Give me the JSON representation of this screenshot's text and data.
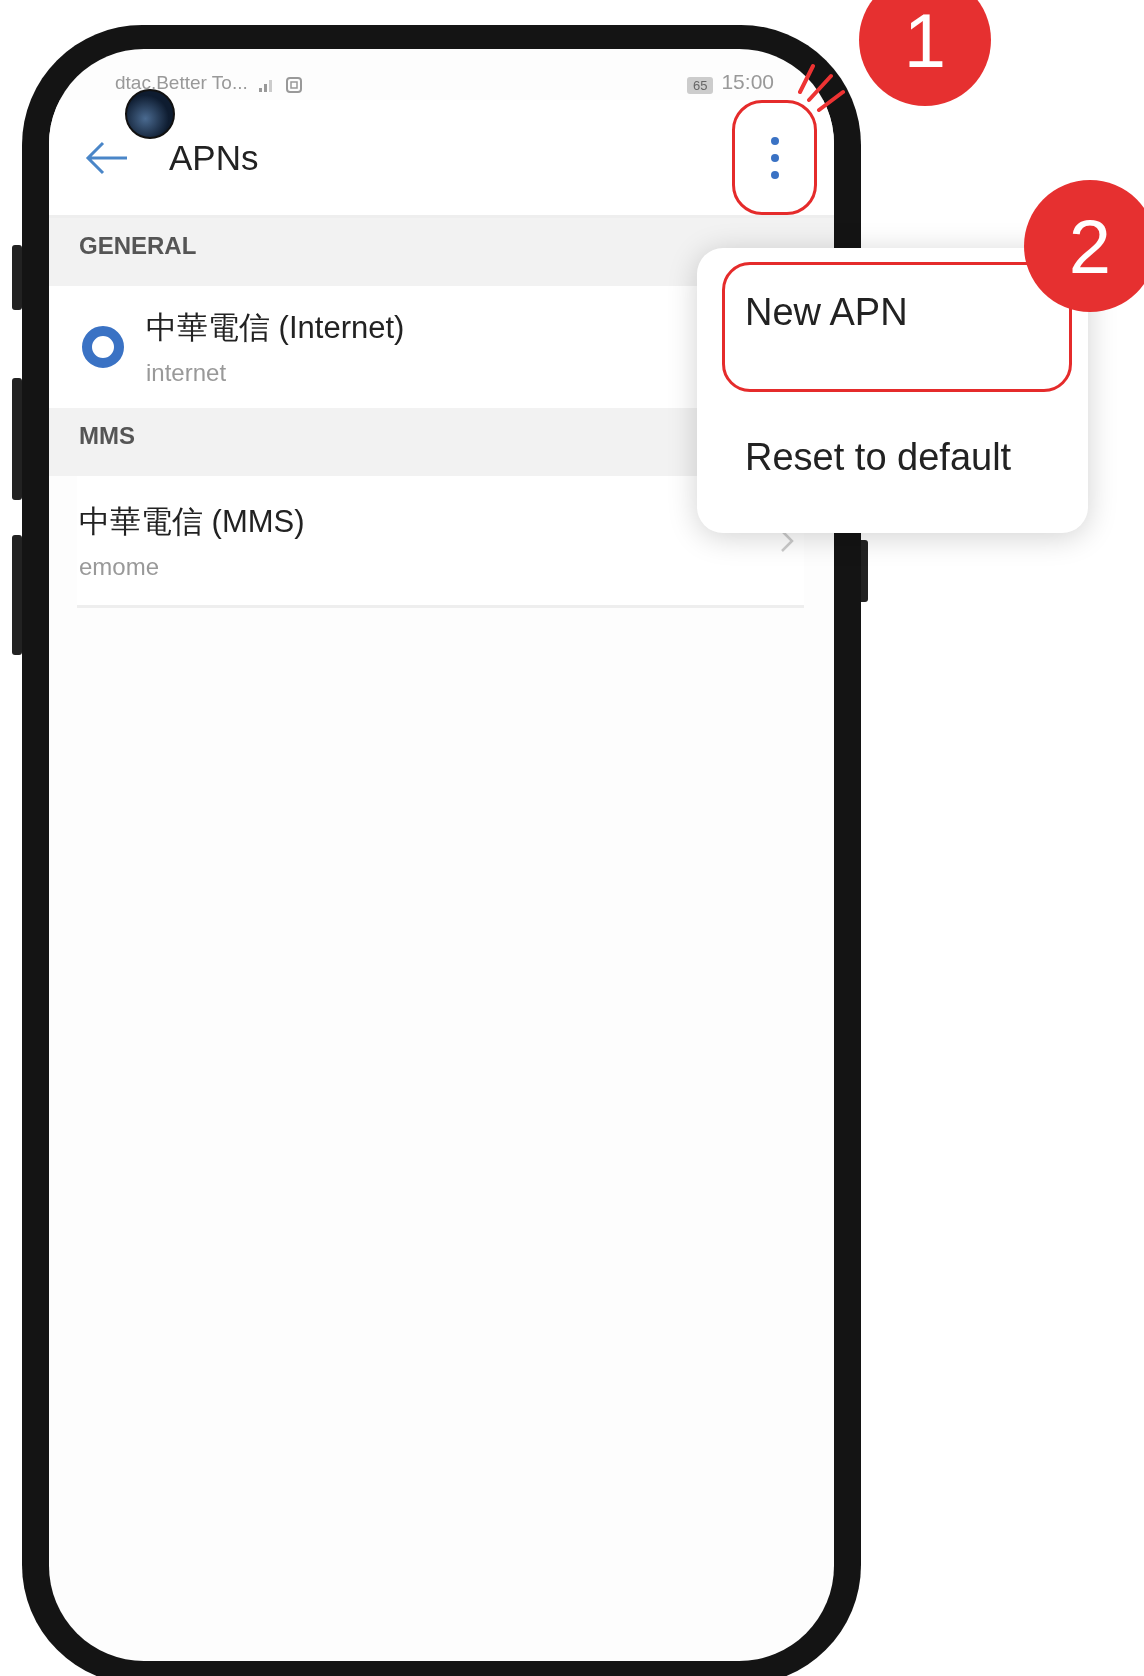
{
  "status_bar": {
    "carrier": "dtac.Better To...",
    "battery": "65",
    "time": "15:00"
  },
  "toolbar": {
    "title": "APNs",
    "more_button": {
      "highlighted": true
    }
  },
  "sections": [
    {
      "header": "GENERAL",
      "items": [
        {
          "kind": "radio",
          "title": "中華電信 (Internet)",
          "subtitle": "internet",
          "selected": true
        }
      ]
    },
    {
      "header": "MMS",
      "items": [
        {
          "kind": "link",
          "title": "中華電信 (MMS)",
          "subtitle": "emome"
        }
      ]
    }
  ],
  "menu": {
    "items": [
      {
        "label": "New APN",
        "highlighted": true
      },
      {
        "label": "Reset to default",
        "highlighted": false
      }
    ]
  },
  "step_badges": [
    "1",
    "2"
  ]
}
